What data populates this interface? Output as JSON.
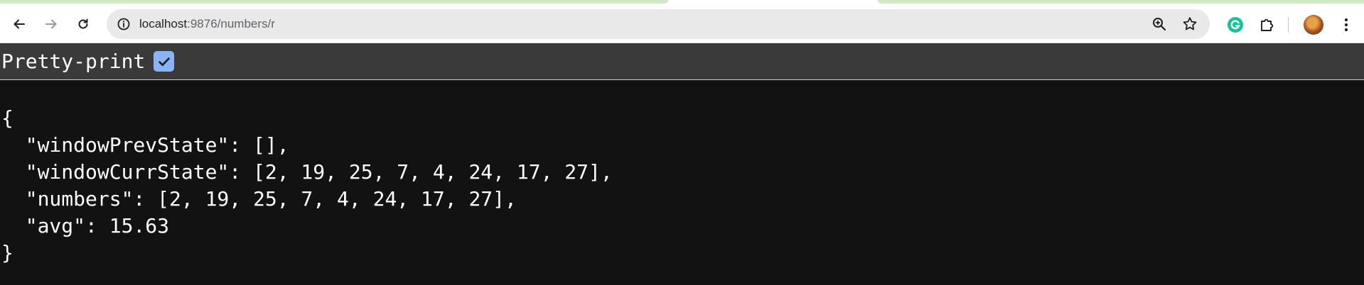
{
  "browser": {
    "url_host": "localhost",
    "url_path": ":9876/numbers/r",
    "icons": {
      "back": "arrow-left-icon",
      "forward": "arrow-right-icon",
      "reload": "reload-icon",
      "site_info": "site-info-icon",
      "zoom": "zoom-in-icon",
      "bookmark": "star-icon",
      "grammarly": "grammarly-icon",
      "extensions": "puzzle-icon",
      "menu": "kebab-menu-icon"
    }
  },
  "viewer": {
    "pretty_print_label": "Pretty-print",
    "pretty_print_checked": true
  },
  "json": {
    "open_brace": "{",
    "line1": "  \"windowPrevState\": [],",
    "line2": "  \"windowCurrState\": [2, 19, 25, 7, 4, 24, 17, 27],",
    "line3": "  \"numbers\": [2, 19, 25, 7, 4, 24, 17, 27],",
    "line4": "  \"avg\": 15.63",
    "close_brace": "}"
  },
  "colors": {
    "page_background": "#121212",
    "pp_bar": "#3a3a3a",
    "checkbox": "#8ab4f8",
    "text": "#ffffff"
  }
}
